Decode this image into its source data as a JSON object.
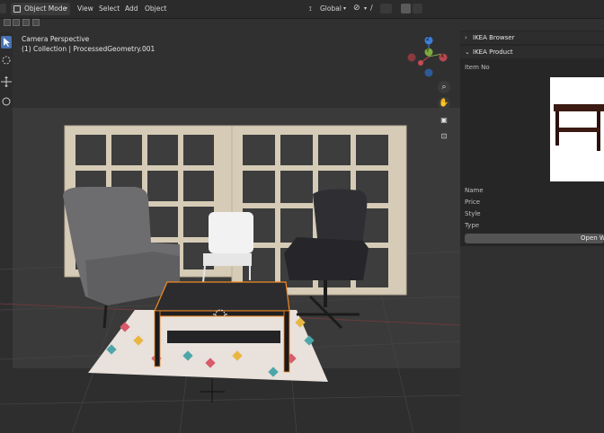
{
  "header": {
    "mode_label": "Object Mode",
    "menu": [
      "View",
      "Select",
      "Add",
      "Object"
    ],
    "transform_orientation": "Global"
  },
  "viewport": {
    "title": "Camera Perspective",
    "subtitle": "(1) Collection | ProcessedGeometry.001"
  },
  "gizmo": {
    "z_label": "Z",
    "y_label": "Y",
    "x_label": "X",
    "colors": {
      "x": "#c74b55",
      "y": "#7ea93f",
      "z": "#3d7ed8"
    }
  },
  "nav_icons": [
    "zoom-icon",
    "hand-icon",
    "camera-icon",
    "lock-icon"
  ],
  "panel": {
    "browser_label": "IKEA Browser",
    "product_label": "IKEA Product",
    "item_no_label": "Item No",
    "fields": [
      "Name",
      "Price",
      "Style",
      "Type"
    ],
    "open_button": "Open W"
  },
  "colors": {
    "accent": "#4772b3",
    "selection": "#f08a24",
    "background": "#303030"
  }
}
